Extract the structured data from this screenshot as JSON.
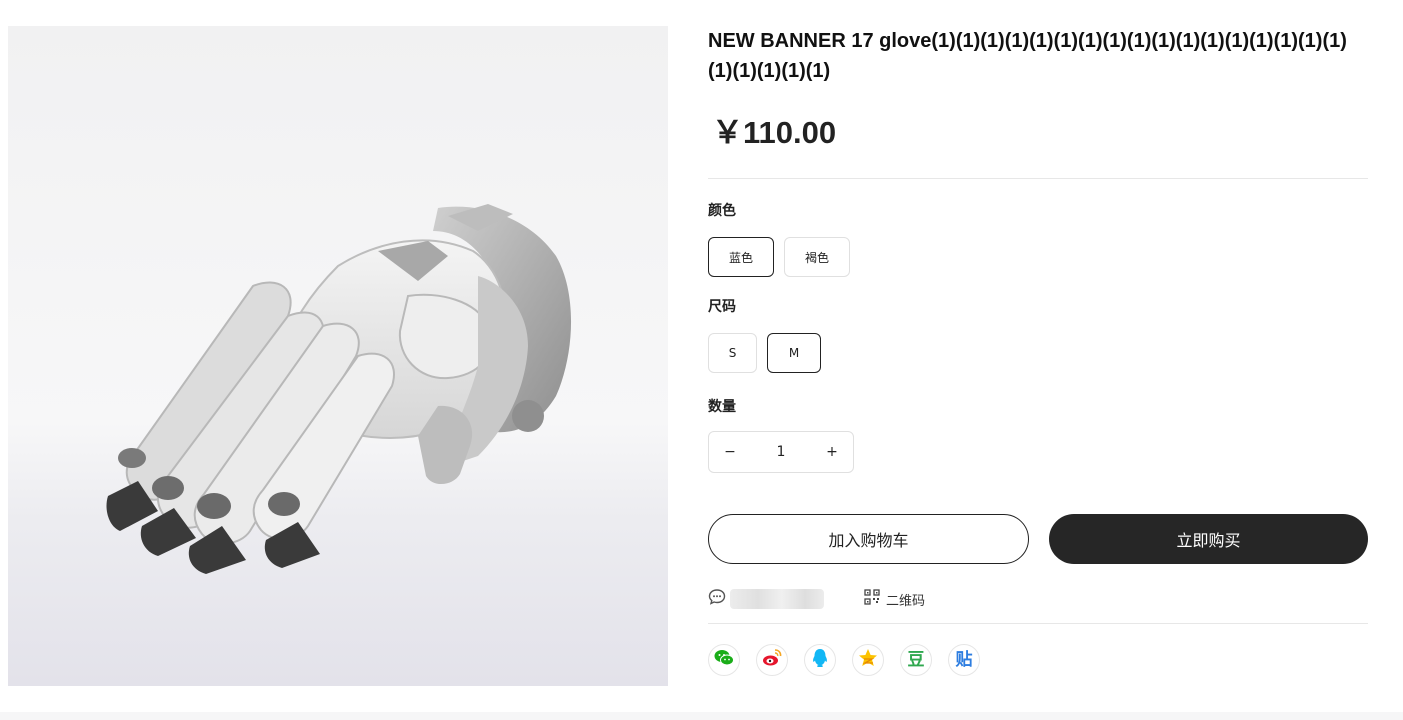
{
  "product": {
    "title": "NEW BANNER 17 glove(1)(1)(1)(1)(1)(1)(1)(1)(1)(1)(1)(1)(1)(1)(1)(1)(1)(1)(1)(1)(1)(1)",
    "price": "￥110.00",
    "image_icon": "glove-image"
  },
  "options": {
    "color_label": "颜色",
    "colors": [
      "蓝色",
      "褐色"
    ],
    "selected_color": "蓝色",
    "size_label": "尺码",
    "sizes": [
      "S",
      "M"
    ],
    "selected_size": "M",
    "qty_label": "数量",
    "qty_minus": "−",
    "qty_value": "1",
    "qty_plus": "+"
  },
  "actions": {
    "add_to_cart": "加入购物车",
    "buy_now": "立即购买"
  },
  "meta": {
    "chat_icon": "chat-icon",
    "qr_icon": "qrcode-icon",
    "qr_label": "二维码"
  },
  "share": [
    {
      "name": "wechat-icon",
      "color": "#1aad19"
    },
    {
      "name": "weibo-icon",
      "color": "#e6162d"
    },
    {
      "name": "qq-icon",
      "color": "#12b7f5"
    },
    {
      "name": "qzone-icon",
      "color": "#fcc300"
    },
    {
      "name": "douban-icon",
      "color": "#2fa84f"
    },
    {
      "name": "tieba-icon",
      "color": "#2d7de0"
    }
  ],
  "share_labels": {
    "douban": "豆",
    "tieba": "贴"
  },
  "colors": {
    "buy_bg": "#262626",
    "border": "#e0e0e0"
  }
}
